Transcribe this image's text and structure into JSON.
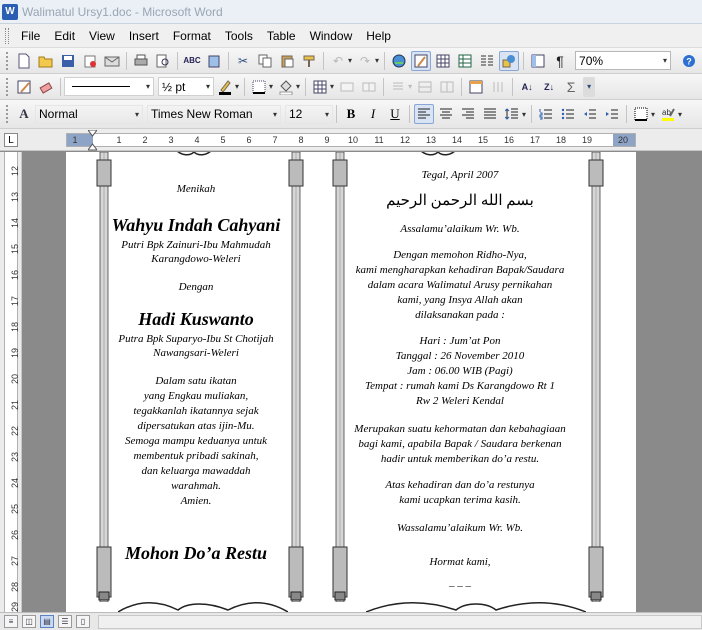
{
  "window": {
    "title": "Walimatul Ursy1.doc - Microsoft Word",
    "app_icon": "W"
  },
  "menu": [
    {
      "label": "File",
      "key": "F"
    },
    {
      "label": "Edit",
      "key": "E"
    },
    {
      "label": "View",
      "key": "V"
    },
    {
      "label": "Insert",
      "key": "I"
    },
    {
      "label": "Format",
      "key": "o"
    },
    {
      "label": "Tools",
      "key": "T"
    },
    {
      "label": "Table",
      "key": "a"
    },
    {
      "label": "Window",
      "key": "W"
    },
    {
      "label": "Help",
      "key": "H"
    }
  ],
  "standard_toolbar": {
    "zoom": "70%"
  },
  "drawing_toolbar": {
    "line_weight": "½ pt"
  },
  "formatting_toolbar": {
    "style": "Normal",
    "font": "Times New Roman",
    "size": "12"
  },
  "ruler": {
    "numbers": [
      "1",
      "1",
      "2",
      "3",
      "4",
      "5",
      "6",
      "7",
      "8",
      "9",
      "10",
      "11",
      "12",
      "13",
      "14",
      "15",
      "16",
      "17",
      "18",
      "19",
      "20"
    ],
    "vertical_numbers": [
      "12",
      "13",
      "14",
      "15",
      "16",
      "17",
      "18",
      "19",
      "20",
      "21",
      "22",
      "23",
      "24",
      "25",
      "26",
      "27",
      "28",
      "29"
    ]
  },
  "document": {
    "left": {
      "menikah": "Menikah",
      "bride_name": "Wahyu Indah Cahyani",
      "bride_parents": "Putri Bpk Zainuri-Ibu Mahmudah",
      "bride_address": "Karangdowo-Weleri",
      "dengan": "Dengan",
      "groom_name": "Hadi Kuswanto",
      "groom_parents": "Putra Bpk Suparyo-Ibu St Chotijah",
      "groom_address": "Nawangsari-Weleri",
      "prayer": [
        "Dalam satu ikatan",
        "yang Engkau muliakan,",
        "tegakkanlah ikatannya sejak",
        "dipersatukan atas ijin-Mu.",
        "Semoga mampu keduanya untuk",
        "membentuk pribadi sakinah,",
        "dan keluarga mawaddah",
        "warahmah.",
        "Amien."
      ],
      "doa_restu": "Mohon Do’a Restu"
    },
    "right": {
      "date": "Tegal, April 2007",
      "basmalah": "بسم الله الرحمن الرحيم",
      "greeting": "Assalamu’alaikum Wr. Wb.",
      "intro": [
        "Dengan memohon Ridho-Nya,",
        "kami mengharapkan kehadiran Bapak/Saudara",
        "dalam acara Walimatul Arusy pernikahan",
        "kami, yang Insya Allah akan",
        "dilaksanakan pada :"
      ],
      "hari": "Hari :  Jum’at Pon",
      "tanggal": "Tanggal :  26 November 2010",
      "jam": "Jam :  06.00 WIB (Pagi)",
      "tempat": [
        "Tempat :  rumah kami Ds Karangdowo Rt 1",
        "Rw 2 Weleri Kendal"
      ],
      "closing": [
        "Merupakan suatu kehormatan dan kebahagiaan",
        "bagi kami, apabila Bapak / Saudara berkenan",
        "hadir untuk memberikan do’a restu."
      ],
      "thanks": [
        "Atas kehadiran dan do’a restunya",
        "kami ucapkan terima kasih."
      ],
      "farewell": "Wassalamu’alaikum Wr. Wb.",
      "hormat": "Hormat kami,",
      "signature_dashes": "_ _ _"
    }
  },
  "icons": {
    "standard": [
      "new-icon",
      "open-icon",
      "save-icon",
      "permission-icon",
      "print-icon",
      "print-preview-icon",
      "spelling-icon",
      "research-icon",
      "cut-icon",
      "copy-icon",
      "paste-icon",
      "format-painter-icon",
      "undo-icon",
      "redo-icon",
      "hyperlink-icon",
      "tables-borders-icon",
      "insert-table-icon",
      "insert-excel-icon",
      "columns-icon",
      "drawing-icon",
      "document-map-icon",
      "show-hide-icon",
      "help-icon"
    ]
  }
}
